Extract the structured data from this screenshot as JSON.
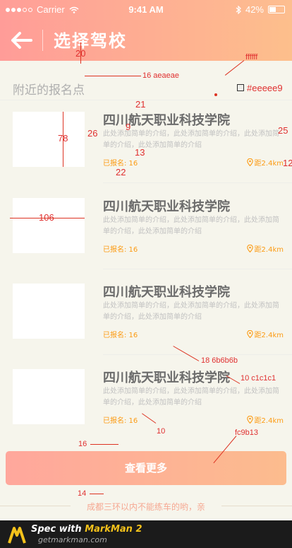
{
  "status_bar": {
    "carrier": "Carrier",
    "time": "9:41 AM",
    "battery": "42%"
  },
  "header": {
    "title": "选择驾校"
  },
  "section": {
    "title": "附近的报名点"
  },
  "schools": [
    {
      "name": "四川航天职业科技学院",
      "desc": "此处添加简单的介绍，此处添加简单的介绍，此处添加简单的介绍，此处添加简单的介绍",
      "count": "已报名: 16",
      "distance": "距2.4km"
    },
    {
      "name": "四川航天职业科技学院",
      "desc": "此处添加简单的介绍，此处添加简单的介绍，此处添加简单的介绍，此处添加简单的介绍",
      "count": "已报名: 16",
      "distance": "距2.4km"
    },
    {
      "name": "四川航天职业科技学院",
      "desc": "此处添加简单的介绍，此处添加简单的介绍，此处添加简单的介绍，此处添加简单的介绍",
      "count": "已报名: 16",
      "distance": "距2.4km"
    },
    {
      "name": "四川航天职业科技学院",
      "desc": "此处添加简单的介绍，此处添加简单的介绍，此处添加简单的介绍，此处添加简单的介绍",
      "count": "已报名: 16",
      "distance": "距2.4km"
    }
  ],
  "more_button": {
    "label": "查看更多"
  },
  "footer": {
    "note": "成都三环以内不能练车的哟，亲"
  },
  "markman": {
    "title_prefix": "Spec with ",
    "title_brand": "MarkMan 2",
    "url": "getmarkman.com"
  },
  "annotations": {
    "header_gap": "20",
    "bg_color": "ffffff",
    "section_font": "16 aeaeae",
    "line_color": "#eeeee9",
    "gap_21": "21",
    "thumb_h": "78",
    "gap_26": "26",
    "gap_9": "9",
    "gap_25": "25",
    "gap_13": "13",
    "gap_22": "22",
    "gap_12": "12",
    "thumb_w": "106",
    "name_font": "18 6b6b6b",
    "desc_font": "10  c1c1c1",
    "count_font": "10",
    "accent_label": "fc9b13",
    "btn_font": "16",
    "footer_font": "14"
  },
  "colors": {
    "accent": "#fc9b13",
    "title": "#6b6b6b",
    "desc": "#c1c1c1",
    "section": "#aeaeae",
    "line": "#eeeee9"
  }
}
